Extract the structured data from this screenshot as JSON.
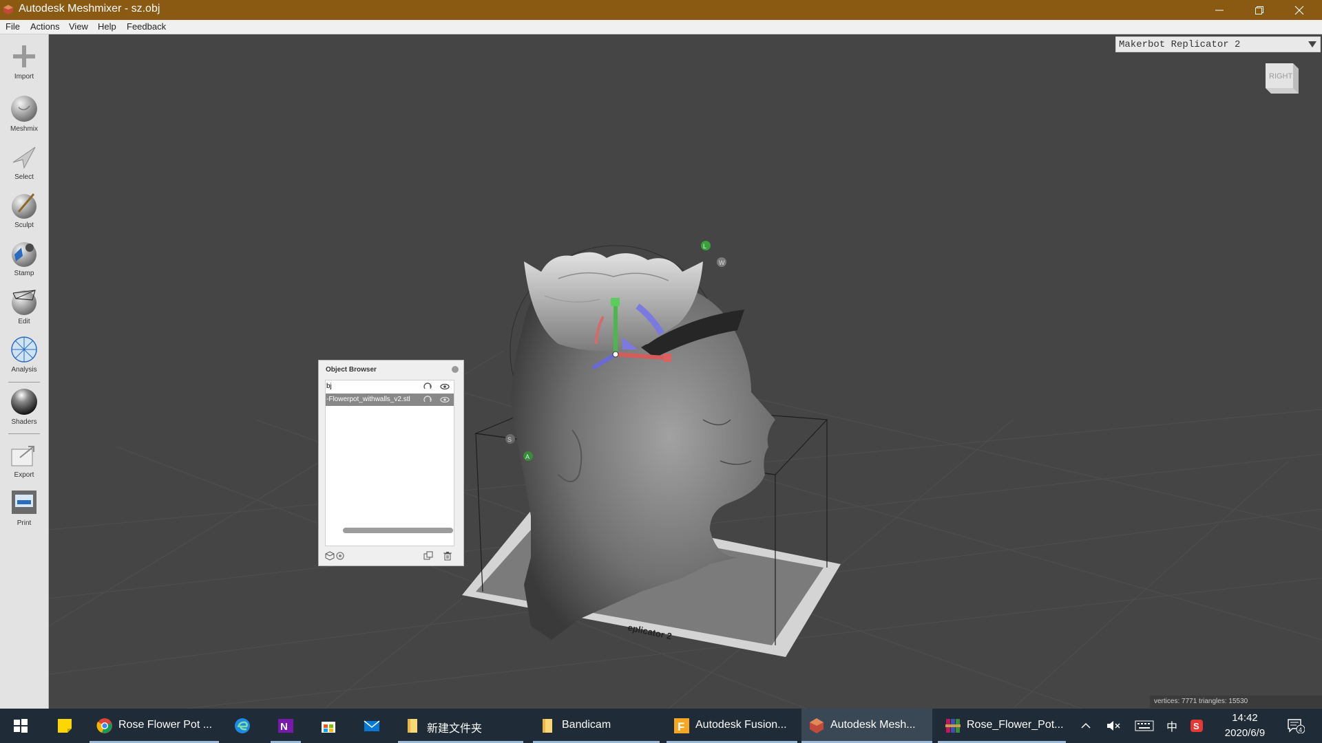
{
  "window": {
    "title": "Autodesk Meshmixer - sz.obj",
    "title_bar_color": "#8a5a13"
  },
  "menu": {
    "items": [
      "File",
      "Actions",
      "View",
      "Help",
      "Feedback"
    ]
  },
  "toolbar": {
    "tools": [
      {
        "label": "Import",
        "icon": "plus-icon"
      },
      {
        "label": "Meshmix",
        "icon": "meshmix-ball-icon"
      },
      {
        "label": "Select",
        "icon": "select-arrow-icon"
      },
      {
        "label": "Sculpt",
        "icon": "sculpt-brush-icon"
      },
      {
        "label": "Stamp",
        "icon": "stamp-icon"
      },
      {
        "label": "Edit",
        "icon": "edit-icon"
      },
      {
        "label": "Analysis",
        "icon": "analysis-icon"
      },
      {
        "label": "Shaders",
        "icon": "shader-sphere-icon"
      },
      {
        "label": "Export",
        "icon": "export-icon"
      },
      {
        "label": "Print",
        "icon": "printer-icon"
      }
    ]
  },
  "viewport": {
    "printer": "Makerbot Replicator 2",
    "view_cube_face": "RIGHT",
    "platform_label": "eplicator 2",
    "gizmo_labels": {
      "w": "W",
      "l": "L",
      "s": "S",
      "a": "A"
    },
    "stats": "vertices: 7771 triangles: 15530"
  },
  "object_browser": {
    "title": "Object Browser",
    "items": [
      {
        "name": "bj",
        "selected": false
      },
      {
        "name": "-Flowerpot_withwalls_v2.stl",
        "selected": true
      }
    ]
  },
  "taskbar": {
    "items": [
      {
        "label": "",
        "icon": "windows-start-icon"
      },
      {
        "label": "",
        "icon": "sticky-notes-icon"
      },
      {
        "label": "Rose Flower Pot ...",
        "icon": "chrome-icon"
      },
      {
        "label": "",
        "icon": "edge-icon"
      },
      {
        "label": "",
        "icon": "onenote-icon"
      },
      {
        "label": "",
        "icon": "store-icon"
      },
      {
        "label": "",
        "icon": "mail-icon"
      },
      {
        "label": "新建文件夹",
        "icon": "folder-icon"
      },
      {
        "label": "Bandicam",
        "icon": "folder-icon"
      },
      {
        "label": "Autodesk Fusion...",
        "icon": "fusion-icon"
      },
      {
        "label": "Autodesk Mesh...",
        "icon": "meshmixer-icon"
      },
      {
        "label": "Rose_Flower_Pot...",
        "icon": "winrar-icon"
      }
    ],
    "tray": {
      "ime": "中",
      "time": "14:42",
      "date": "2020/6/9",
      "notifications": "4"
    }
  }
}
